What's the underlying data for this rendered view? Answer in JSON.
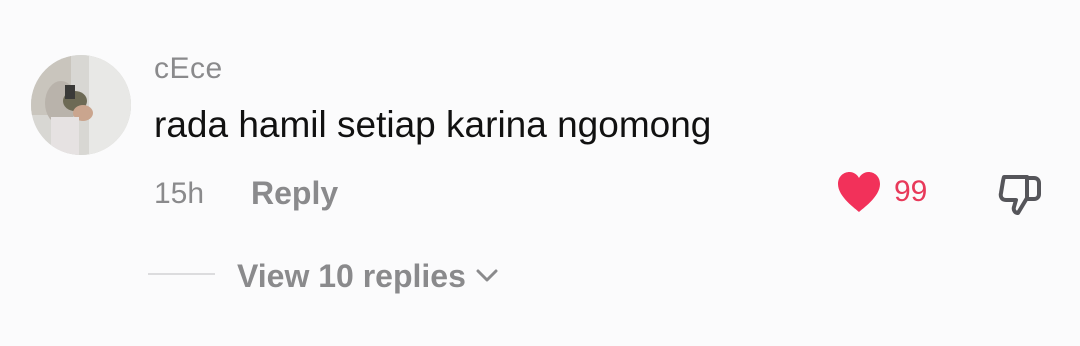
{
  "comment": {
    "username": "cEce",
    "text": "rada hamil setiap karina ngomong",
    "timestamp": "15h",
    "reply_label": "Reply",
    "like_count": "99",
    "liked": true,
    "view_replies_label": "View 10 replies"
  },
  "colors": {
    "background": "#fbfbfc",
    "username": "#8a8a8c",
    "text": "#111111",
    "like": "#f2315a",
    "like_count": "#e8395a",
    "muted": "#8a8a8c"
  },
  "icons": {
    "avatar": "user-avatar",
    "like": "heart-icon",
    "dislike": "thumbs-down-icon",
    "expand": "chevron-down-icon"
  }
}
